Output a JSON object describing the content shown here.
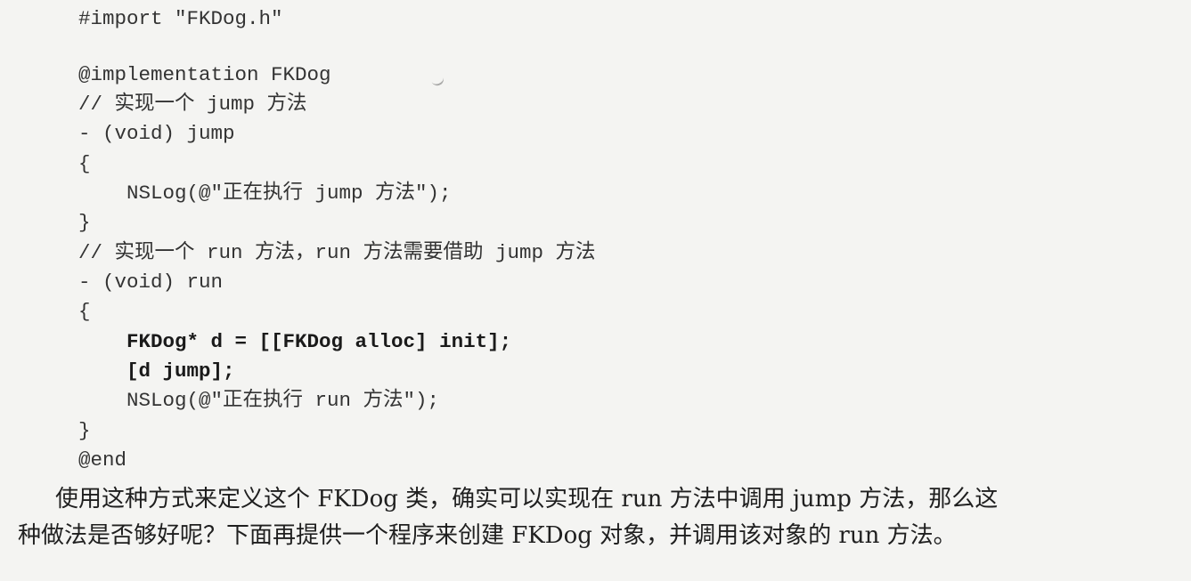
{
  "code_lines": [
    "#import \"FKDog.h\"",
    "",
    "@implementation FKDog",
    "// 实现一个 jump 方法",
    "- (void) jump",
    "{",
    "    NSLog(@\"正在执行 jump 方法\");",
    "}",
    "// 实现一个 run 方法，run 方法需要借助 jump 方法",
    "- (void) run",
    "{",
    "    FKDog* d = [[FKDog alloc] init];",
    "    [d jump];",
    "    NSLog(@\"正在执行 run 方法\");",
    "}",
    "@end"
  ],
  "paragraph_lines": [
    "使用这种方式来定义这个 FKDog 类，确实可以实现在 run 方法中调用 jump 方法，那么这",
    "种做法是否够好呢？下面再提供一个程序来创建 FKDog 对象，并调用该对象的 run 方法。"
  ]
}
